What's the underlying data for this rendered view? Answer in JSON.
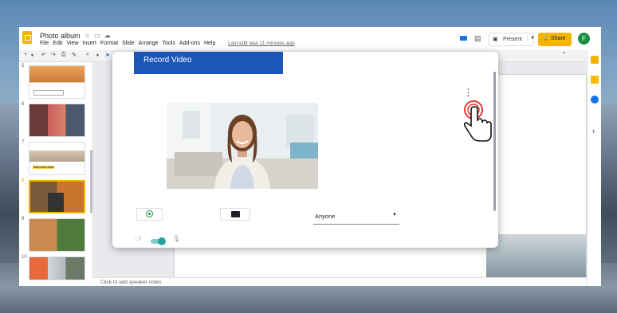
{
  "app": {
    "doc_title": "Photo album",
    "menu": [
      "File",
      "Edit",
      "View",
      "Insert",
      "Format",
      "Slide",
      "Arrange",
      "Tools",
      "Add-ons",
      "Help"
    ],
    "last_edit": "Last edit was 11 minutes ago",
    "present_label": "Present",
    "share_label": "Share",
    "avatar_initial": "F",
    "speaker_notes_placeholder": "Click to add speaker notes"
  },
  "filmstrip": {
    "slides": [
      {
        "number": "5",
        "caption": ""
      },
      {
        "number": "6",
        "caption": ""
      },
      {
        "number": "7",
        "caption": "Soft Cool Colors"
      },
      {
        "number": "8",
        "caption": ""
      },
      {
        "number": "9",
        "caption": ""
      },
      {
        "number": "10",
        "caption": ""
      }
    ],
    "selected_slide": "8"
  },
  "dialog": {
    "title": "Record Video",
    "audience_select": {
      "value": "Anyone"
    },
    "mic_toggle_on": true
  },
  "colors": {
    "accent_blue": "#1d56b9",
    "share_yellow": "#f4b400",
    "record_green": "#1e8e3e",
    "toggle_teal": "#26a69a",
    "hand_red": "#e53935"
  }
}
